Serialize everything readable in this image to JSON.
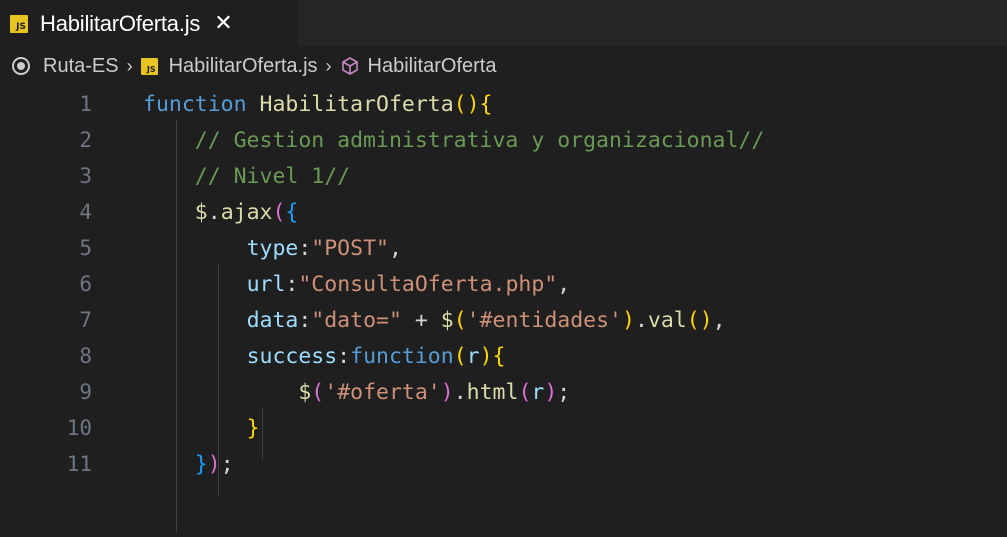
{
  "tab": {
    "badge": "JS",
    "filename": "HabilitarOferta.js",
    "close_glyph": "✕"
  },
  "breadcrumb": {
    "folder": "Ruta-ES",
    "separator": "›",
    "file": "HabilitarOferta.js",
    "symbol": "HabilitarOferta"
  },
  "colors": {
    "editor_bg": "#1f1f1f",
    "keyword": "#569cd6",
    "function": "#dcdcaa",
    "comment": "#6a9955",
    "string": "#ce9178",
    "property": "#9cdcfe",
    "bracket_gold": "#ffd700",
    "bracket_purple": "#da70d6",
    "bracket_blue": "#179fff",
    "js_badge": "#e8c422"
  },
  "icons": {
    "breadcrumb_folder": "target-circle-icon",
    "breadcrumb_file": "js-file-icon",
    "breadcrumb_symbol": "cube-symbol-icon",
    "tab_file": "js-file-icon",
    "tab_close": "close-icon"
  },
  "editor": {
    "line_numbers": [
      "1",
      "2",
      "3",
      "4",
      "5",
      "6",
      "7",
      "8",
      "9",
      "10",
      "11"
    ],
    "lines": [
      [
        {
          "t": "function ",
          "c": "kw"
        },
        {
          "t": "HabilitarOferta",
          "c": "fn"
        },
        {
          "t": "(){",
          "c": "br1"
        }
      ],
      [
        {
          "t": "    // Gestion administrativa y organizacional//",
          "c": "cm"
        }
      ],
      [
        {
          "t": "    // Nivel 1//",
          "c": "cm"
        }
      ],
      [
        {
          "t": "    ",
          "c": "pl"
        },
        {
          "t": "$",
          "c": "fn"
        },
        {
          "t": ".",
          "c": "pl"
        },
        {
          "t": "ajax",
          "c": "fn"
        },
        {
          "t": "(",
          "c": "br2"
        },
        {
          "t": "{",
          "c": "br3"
        }
      ],
      [
        {
          "t": "        ",
          "c": "pl"
        },
        {
          "t": "type",
          "c": "var"
        },
        {
          "t": ":",
          "c": "pl"
        },
        {
          "t": "\"POST\"",
          "c": "str"
        },
        {
          "t": ",",
          "c": "pl"
        }
      ],
      [
        {
          "t": "        ",
          "c": "pl"
        },
        {
          "t": "url",
          "c": "var"
        },
        {
          "t": ":",
          "c": "pl"
        },
        {
          "t": "\"ConsultaOferta.php\"",
          "c": "str"
        },
        {
          "t": ",",
          "c": "pl"
        }
      ],
      [
        {
          "t": "        ",
          "c": "pl"
        },
        {
          "t": "data",
          "c": "var"
        },
        {
          "t": ":",
          "c": "pl"
        },
        {
          "t": "\"dato=\"",
          "c": "str"
        },
        {
          "t": " + ",
          "c": "pl"
        },
        {
          "t": "$",
          "c": "fn"
        },
        {
          "t": "(",
          "c": "br1"
        },
        {
          "t": "'#entidades'",
          "c": "str"
        },
        {
          "t": ")",
          "c": "br1"
        },
        {
          "t": ".",
          "c": "pl"
        },
        {
          "t": "val",
          "c": "fn"
        },
        {
          "t": "()",
          "c": "br1"
        },
        {
          "t": ",",
          "c": "pl"
        }
      ],
      [
        {
          "t": "        ",
          "c": "pl"
        },
        {
          "t": "success",
          "c": "var"
        },
        {
          "t": ":",
          "c": "pl"
        },
        {
          "t": "function",
          "c": "kw"
        },
        {
          "t": "(",
          "c": "br1"
        },
        {
          "t": "r",
          "c": "var"
        },
        {
          "t": ")",
          "c": "br1"
        },
        {
          "t": "{",
          "c": "br1"
        }
      ],
      [
        {
          "t": "            ",
          "c": "pl"
        },
        {
          "t": "$",
          "c": "fn"
        },
        {
          "t": "(",
          "c": "br2"
        },
        {
          "t": "'#oferta'",
          "c": "str"
        },
        {
          "t": ")",
          "c": "br2"
        },
        {
          "t": ".",
          "c": "pl"
        },
        {
          "t": "html",
          "c": "fn"
        },
        {
          "t": "(",
          "c": "br2"
        },
        {
          "t": "r",
          "c": "var"
        },
        {
          "t": ")",
          "c": "br2"
        },
        {
          "t": ";",
          "c": "pl"
        }
      ],
      [
        {
          "t": "        ",
          "c": "pl"
        },
        {
          "t": "}",
          "c": "br1"
        }
      ],
      [
        {
          "t": "    ",
          "c": "pl"
        },
        {
          "t": "}",
          "c": "br3"
        },
        {
          "t": ")",
          "c": "br2"
        },
        {
          "t": ";",
          "c": "pl"
        }
      ]
    ]
  }
}
